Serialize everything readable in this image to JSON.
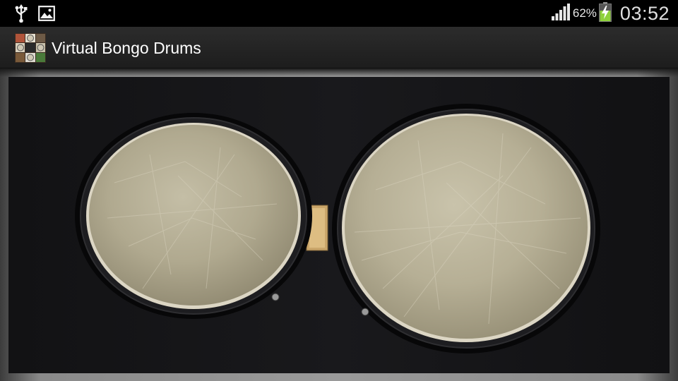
{
  "status_bar": {
    "left_icons": [
      "usb-icon",
      "image-notification-icon"
    ],
    "signal_icon": "signal-bars-icon",
    "battery_percent": "62%",
    "battery_icon": "battery-charging-icon",
    "time": "03:52"
  },
  "action_bar": {
    "app_icon": "bongo-collage-icon",
    "title": "Virtual Bongo Drums"
  },
  "drums": {
    "left_drum": "left-bongo-drum",
    "right_drum": "right-bongo-drum"
  },
  "colors": {
    "status_bar_bg": "#000000",
    "action_bar_bg": "#262626",
    "drum_bg": "#0d0d0f",
    "drum_head": "#b9b29a",
    "battery_green": "#8ed13a"
  }
}
